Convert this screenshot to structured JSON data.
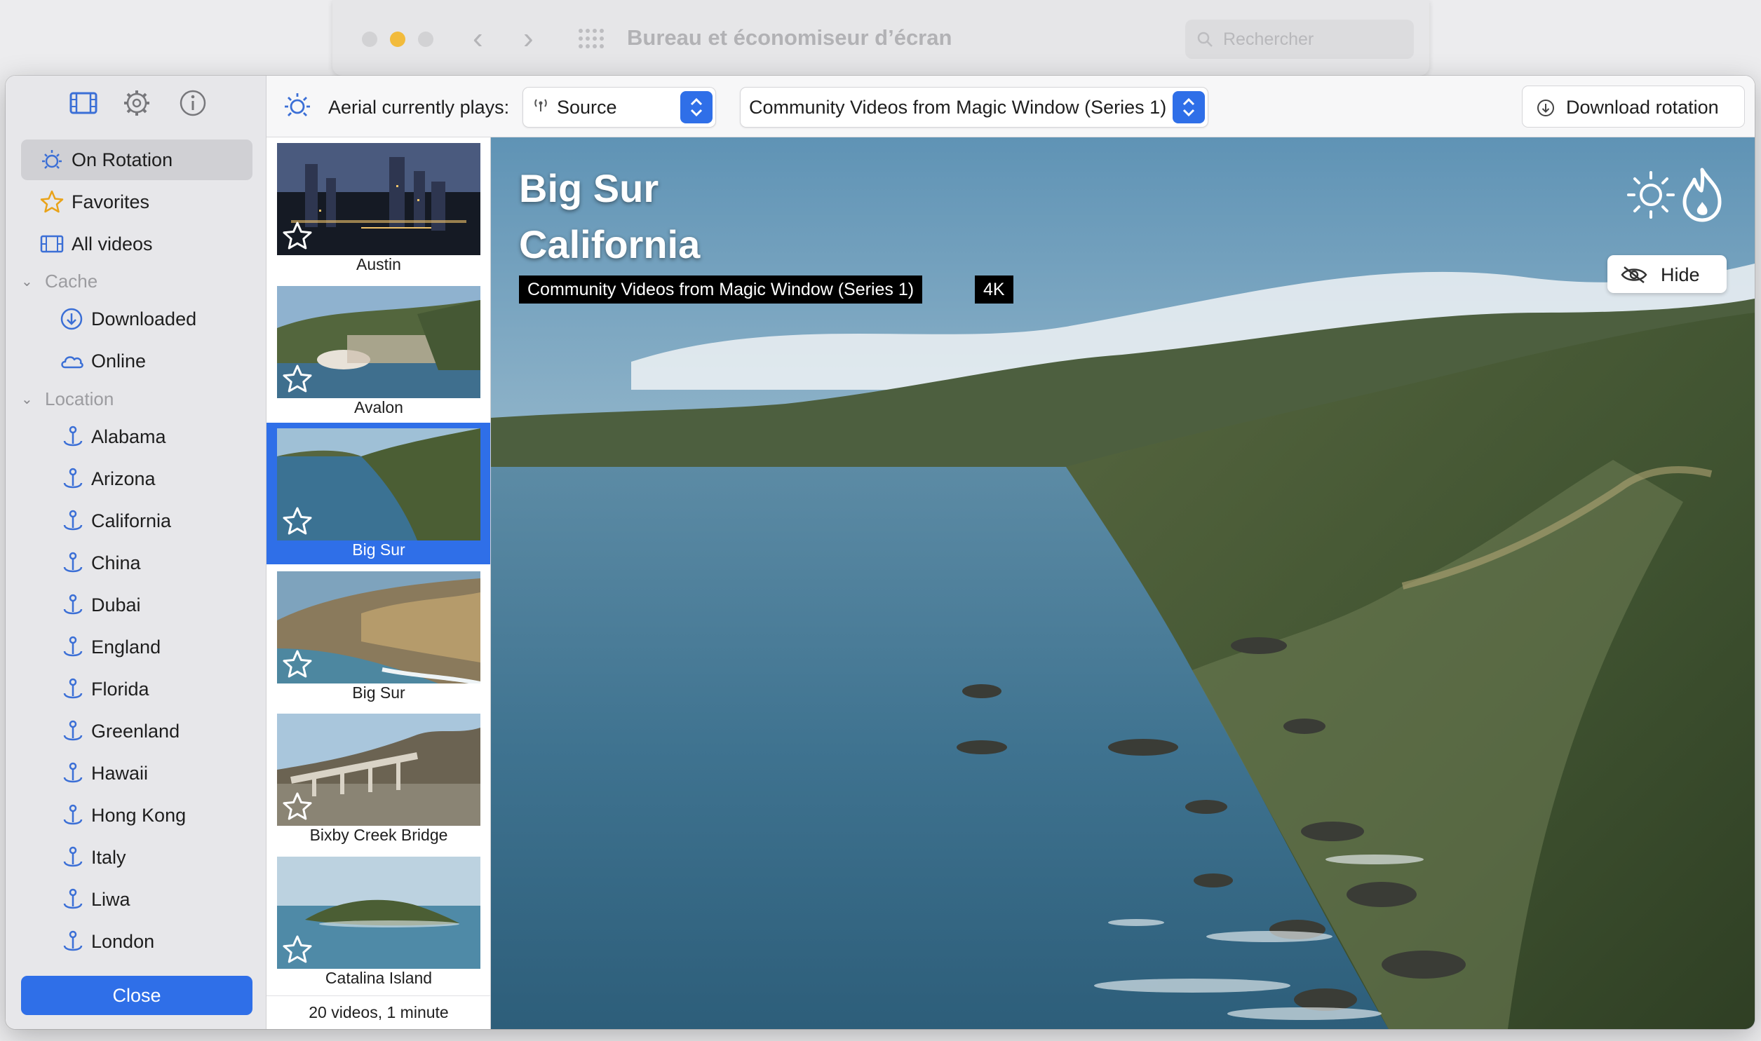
{
  "background_window": {
    "title": "Bureau et économiseur d’écran",
    "search_placeholder": "Rechercher"
  },
  "sidebar": {
    "top_icons": [
      "film-icon",
      "gear-icon",
      "info-icon"
    ],
    "items": [
      {
        "label": "On Rotation",
        "icon": "rotation-sun-icon",
        "active": true
      },
      {
        "label": "Favorites",
        "icon": "star-icon"
      },
      {
        "label": "All videos",
        "icon": "film-icon"
      }
    ],
    "cache_header": "Cache",
    "cache_items": [
      {
        "label": "Downloaded",
        "icon": "download-icon"
      },
      {
        "label": "Online",
        "icon": "cloud-icon"
      }
    ],
    "location_header": "Location",
    "locations": [
      "Alabama",
      "Arizona",
      "California",
      "China",
      "Dubai",
      "England",
      "Florida",
      "Greenland",
      "Hawaii",
      "Hong Kong",
      "Italy",
      "Liwa",
      "London"
    ],
    "close_label": "Close"
  },
  "toolbar": {
    "label": "Aerial currently plays:",
    "source_label": "Source",
    "collection_label": "Community Videos from Magic Window (Series 1)",
    "download_label": "Download rotation"
  },
  "videos": [
    {
      "name": "Austin",
      "selected": false
    },
    {
      "name": "Avalon",
      "selected": false
    },
    {
      "name": "Big Sur",
      "selected": true
    },
    {
      "name": "Big Sur",
      "selected": false
    },
    {
      "name": "Bixby Creek Bridge",
      "selected": false
    },
    {
      "name": "Catalina Island",
      "selected": false
    }
  ],
  "video_count": "20 videos, 1 minute",
  "preview": {
    "title": "Big Sur",
    "subtitle": "California",
    "collection": "Community Videos from Magic Window (Series 1)",
    "quality": "4K",
    "hide_label": "Hide"
  },
  "colors": {
    "accent": "#2f6fe8",
    "sidebar_bg": "#e7e7ea"
  }
}
